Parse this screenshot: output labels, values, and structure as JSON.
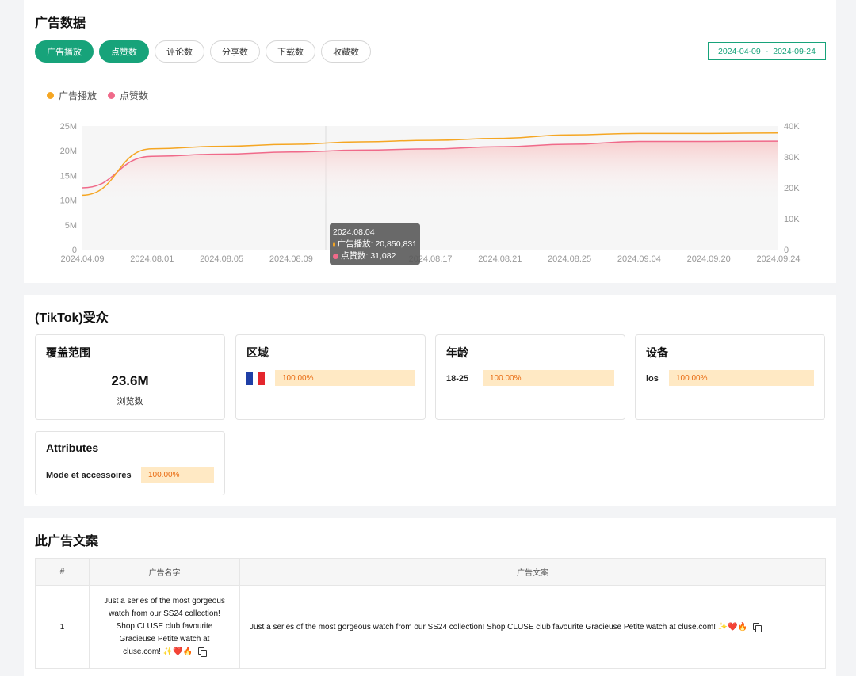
{
  "ad_data": {
    "title": "广告数据",
    "tabs": [
      "广告播放",
      "点赞数",
      "评论数",
      "分享数",
      "下载数",
      "收藏数"
    ],
    "date_start": "2024-04-09",
    "date_sep": "-",
    "date_end": "2024-09-24",
    "tooltip": {
      "date": "2024.08.04",
      "line1": "广告播放: 20,850,831",
      "line2": "点赞数: 31,082"
    }
  },
  "colors": {
    "accent": "#17a37a",
    "plays": "#f5a623",
    "likes": "#f06a8a",
    "bar_bg": "#ffe9c4",
    "bar_text": "#e86a10"
  },
  "chart_data": {
    "type": "line",
    "categories": [
      "2024.04.09",
      "2024.08.01",
      "2024.08.05",
      "2024.08.09",
      "2024.08.13",
      "2024.08.17",
      "2024.08.21",
      "2024.08.25",
      "2024.09.04",
      "2024.09.20",
      "2024.09.24"
    ],
    "x_tick_labels": [
      "2024.04.09",
      "2024.08.01",
      "2024.08.05",
      "2024.08.09",
      "",
      "2024.08.17",
      "2024.08.21",
      "2024.08.25",
      "2024.09.04",
      "2024.09.20",
      "2024.09.24"
    ],
    "series": [
      {
        "name": "广告播放",
        "axis": "left",
        "color": "#f5a623",
        "values": [
          11000000,
          20400000,
          20900000,
          21300000,
          21800000,
          22100000,
          22500000,
          23200000,
          23500000,
          23500000,
          23600000
        ]
      },
      {
        "name": "点赞数",
        "axis": "right",
        "color": "#f06a8a",
        "values": [
          20000,
          30200,
          30900,
          31600,
          32200,
          32600,
          33300,
          34100,
          35000,
          35000,
          35100
        ]
      }
    ],
    "y_left": {
      "ticks": [
        "0",
        "5M",
        "10M",
        "15M",
        "20M",
        "25M"
      ],
      "lim": [
        0,
        25000000
      ]
    },
    "y_right": {
      "ticks": [
        "0",
        "10K",
        "20K",
        "30K",
        "40K"
      ],
      "lim": [
        0,
        40000
      ]
    },
    "grid": false,
    "legend": "top-left"
  },
  "audience": {
    "title": "(TikTok)受众",
    "reach": {
      "title": "覆盖范围",
      "value": "23.6M",
      "label": "浏览数"
    },
    "region": {
      "title": "区域",
      "flag": "france-flag",
      "percent": "100.00%"
    },
    "age": {
      "title": "年龄",
      "label": "18-25",
      "percent": "100.00%"
    },
    "device": {
      "title": "设备",
      "label": "ios",
      "percent": "100.00%"
    },
    "attributes": {
      "title": "Attributes",
      "label": "Mode et accessoires",
      "percent": "100.00%"
    }
  },
  "copy": {
    "title": "此广告文案",
    "headers": [
      "#",
      "广告名字",
      "广告文案"
    ],
    "rows": [
      {
        "index": "1",
        "name": "Just a series of the most gorgeous watch from our SS24 collection! Shop CLUSE club favourite Gracieuse Petite watch at cluse.com!",
        "text": "Just a series of the most gorgeous watch from our SS24 collection! Shop CLUSE club favourite Gracieuse Petite watch at cluse.com!",
        "emoji": "✨❤️🔥"
      }
    ]
  }
}
